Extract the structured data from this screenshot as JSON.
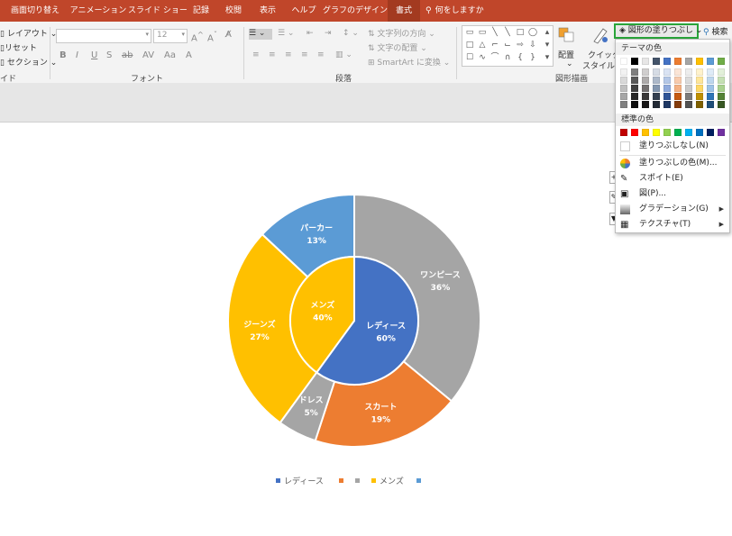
{
  "tabs": [
    {
      "label": "画面切り替え"
    },
    {
      "label": "アニメーション"
    },
    {
      "label": "スライド ショー"
    },
    {
      "label": "記録"
    },
    {
      "label": "校閲"
    },
    {
      "label": "表示"
    },
    {
      "label": "ヘルプ"
    },
    {
      "label": "グラフのデザイン"
    },
    {
      "label": "書式"
    },
    {
      "label": "何をしますか"
    }
  ],
  "ribbon": {
    "slides": {
      "layout": "レイアウト",
      "reset": "リセット",
      "section": "セクション",
      "group": "イド"
    },
    "font": {
      "size": "12",
      "group": "フォント"
    },
    "paragraph": {
      "text_direction": "文字列の方向",
      "align_text": "文字の配置",
      "smartart": "SmartArt に変換",
      "group": "段落"
    },
    "drawing": {
      "arrange": "配置",
      "quick_style": "クイック",
      "quick_style2": "スタイル",
      "group": "図形描画"
    },
    "shape_fill_label": "図形の塗りつぶし",
    "search_label": "検索"
  },
  "fill_menu": {
    "theme_colors_header": "テーマの色",
    "standard_colors_header": "標準の色",
    "theme_colors": [
      [
        "#ffffff",
        "#f2f2f2",
        "#d9d9d9",
        "#bfbfbf",
        "#a6a6a6",
        "#808080"
      ],
      [
        "#000000",
        "#7f7f7f",
        "#595959",
        "#404040",
        "#262626",
        "#0d0d0d"
      ],
      [
        "#e7e6e6",
        "#d0cece",
        "#aeabab",
        "#757171",
        "#3a3838",
        "#171616"
      ],
      [
        "#44546a",
        "#d6dce5",
        "#adb9ca",
        "#8497b0",
        "#333f50",
        "#222a35"
      ],
      [
        "#4472c4",
        "#dae3f3",
        "#b4c7e7",
        "#8faadc",
        "#2f5597",
        "#1f3864"
      ],
      [
        "#ed7d31",
        "#fbe5d6",
        "#f8cbad",
        "#f4b183",
        "#c55a11",
        "#843c0c"
      ],
      [
        "#a5a5a5",
        "#ededed",
        "#dbdbdb",
        "#c9c9c9",
        "#7b7b7b",
        "#525252"
      ],
      [
        "#ffc000",
        "#fff2cc",
        "#ffe699",
        "#ffd966",
        "#bf9000",
        "#7f6000"
      ],
      [
        "#5b9bd5",
        "#deebf7",
        "#bdd7ee",
        "#9dc3e6",
        "#2e75b6",
        "#1f4e79"
      ],
      [
        "#70ad47",
        "#e2f0d9",
        "#c5e0b4",
        "#a9d18e",
        "#548235",
        "#385723"
      ]
    ],
    "standard_colors": [
      "#c00000",
      "#ff0000",
      "#ffc000",
      "#ffff00",
      "#92d050",
      "#00b050",
      "#00b0f0",
      "#0070c0",
      "#002060",
      "#7030a0"
    ],
    "no_fill": "塗りつぶしなし(N)",
    "more_colors": "塗りつぶしの色(M)...",
    "eyedropper": "スポイト(E)",
    "picture": "図(P)...",
    "gradient": "グラデーション(G)",
    "texture": "テクスチャ(T)"
  },
  "chart_data": {
    "type": "pie",
    "subtype": "doughnut-sunburst",
    "inner_ring": [
      {
        "name": "レディース",
        "value": 60,
        "label": "60%",
        "color": "#4472c4"
      },
      {
        "name": "メンズ",
        "value": 40,
        "label": "40%",
        "color": "#ffc000"
      }
    ],
    "outer_ring": [
      {
        "name": "ワンピース",
        "value": 36,
        "label": "36%",
        "color": "#a5a5a5"
      },
      {
        "name": "スカート",
        "value": 19,
        "label": "19%",
        "color": "#ed7d31"
      },
      {
        "name": "ドレス",
        "value": 5,
        "label": "5%",
        "color": "#a5a5a5"
      },
      {
        "name": "ジーンズ",
        "value": 27,
        "label": "27%",
        "color": "#ffc000"
      },
      {
        "name": "パーカー",
        "value": 13,
        "label": "13%",
        "color": "#5b9bd5"
      }
    ],
    "legend_position": "bottom",
    "legend": [
      {
        "name": "レディース",
        "color": "#4472c4"
      },
      {
        "name": "",
        "color": "#ed7d31"
      },
      {
        "name": "",
        "color": "#a5a5a5"
      },
      {
        "name": "メンズ",
        "color": "#ffc000"
      },
      {
        "name": "",
        "color": "#5b9bd5"
      }
    ]
  }
}
